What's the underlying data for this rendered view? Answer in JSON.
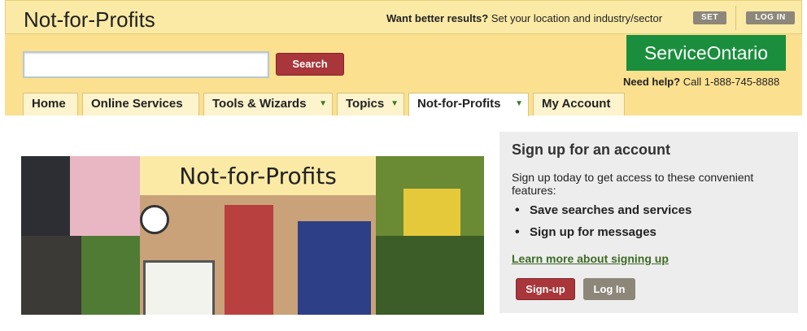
{
  "header": {
    "site_title": "Not-for-Profits",
    "better_results_bold": "Want better results?",
    "better_results_text": "Set your location and industry/sector",
    "set_label": "SET",
    "login_label": "LOG IN"
  },
  "search": {
    "value": "",
    "placeholder": "",
    "button_label": "Search"
  },
  "logo": {
    "text": "ServiceOntario"
  },
  "help": {
    "bold": "Need help?",
    "text": "Call 1-888-745-8888"
  },
  "tabs": [
    {
      "label": "Home",
      "has_arrow": false,
      "active": false
    },
    {
      "label": "Online Services",
      "has_arrow": false,
      "active": false
    },
    {
      "label": "Tools & Wizards",
      "has_arrow": true,
      "active": false
    },
    {
      "label": "Topics",
      "has_arrow": true,
      "active": false
    },
    {
      "label": "Not-for-Profits",
      "has_arrow": true,
      "active": true
    },
    {
      "label": "My Account",
      "has_arrow": false,
      "active": false
    }
  ],
  "tab_arrow": "▼",
  "hero": {
    "title": "Not-for-Profits"
  },
  "signup_panel": {
    "title": "Sign up for an account",
    "description": "Sign up today to get access to these convenient features:",
    "features": [
      "Save searches and services",
      "Sign up for messages"
    ],
    "learn_more_link": "Learn more about signing up",
    "signup_button": "Sign-up",
    "login_button": "Log In"
  },
  "colors": {
    "accent_red": "#a8363a",
    "brand_green": "#1a8e3c",
    "header_yellow": "#fae08f"
  }
}
